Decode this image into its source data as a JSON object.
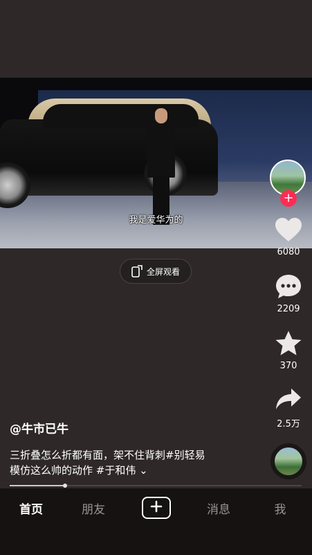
{
  "video": {
    "subtitle": "我是爱华为的"
  },
  "fullscreen": {
    "label": "全屏观看"
  },
  "rail": {
    "likes": "6080",
    "comments": "2209",
    "favorites": "370",
    "shares": "2.5万",
    "follow_symbol": "+"
  },
  "post": {
    "author": "@牛市已牛",
    "description_line1": "三折叠怎么折都有面，架不住背刺#别轻易",
    "description_line2": "模仿这么帅的动作 #于和伟",
    "expand_symbol": "⌄",
    "progress": 0.19
  },
  "tabs": {
    "home": "首页",
    "friends": "朋友",
    "messages": "消息",
    "me": "我"
  },
  "colors": {
    "accent": "#fe2c55",
    "background": "#2e2828",
    "tabbar": "#161212"
  }
}
